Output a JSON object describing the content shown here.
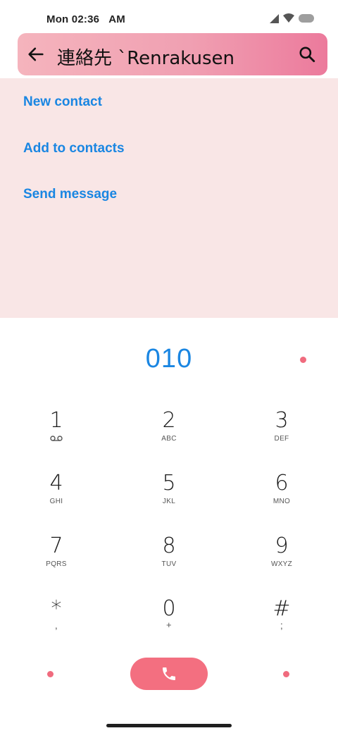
{
  "status_bar": {
    "time": "Mon 02:36",
    "ampm": "AM"
  },
  "header": {
    "title": "連絡先 `Renrakusen",
    "back_icon": "arrow-left-icon",
    "search_icon": "search-icon"
  },
  "suggestions": {
    "items": [
      {
        "label": "New contact"
      },
      {
        "label": "Add to contacts"
      },
      {
        "label": "Send message"
      }
    ]
  },
  "dialer": {
    "typed_number": "010",
    "keys": [
      {
        "digit": "1",
        "letters": "",
        "icon": "voicemail-icon"
      },
      {
        "digit": "2",
        "letters": "ABC"
      },
      {
        "digit": "3",
        "letters": "DEF"
      },
      {
        "digit": "4",
        "letters": "GHI"
      },
      {
        "digit": "5",
        "letters": "JKL"
      },
      {
        "digit": "6",
        "letters": "MNO"
      },
      {
        "digit": "7",
        "letters": "PQRS"
      },
      {
        "digit": "8",
        "letters": "TUV"
      },
      {
        "digit": "9",
        "letters": "WXYZ"
      },
      {
        "digit": "*",
        "letters": ","
      },
      {
        "digit": "0",
        "letters": "+"
      },
      {
        "digit": "#",
        "letters": ";"
      }
    ],
    "call_icon": "phone-icon"
  },
  "colors": {
    "accent_blue": "#1a86e2",
    "call_pink": "#f36f80",
    "panel_bg": "#f9e6e6",
    "header_gradient_start": "#f5b4bd",
    "header_gradient_end": "#ec7a9c"
  }
}
